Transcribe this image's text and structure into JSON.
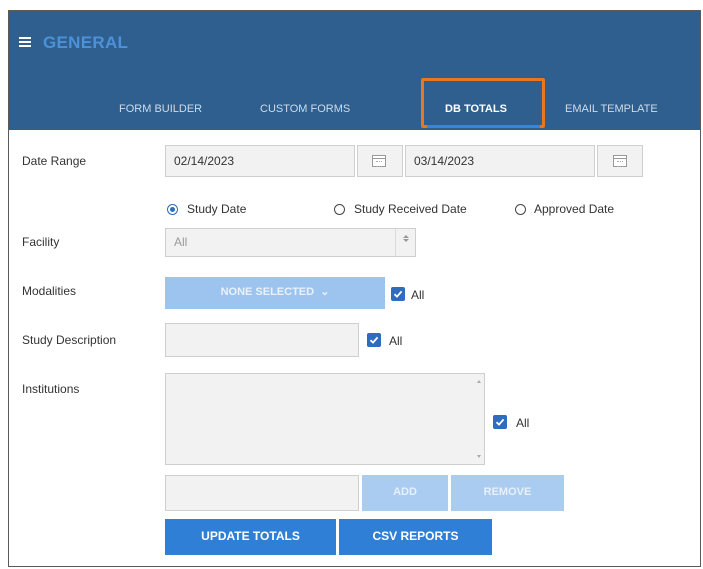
{
  "header": {
    "title": "GENERAL",
    "menu_icon": "hamburger-menu-icon"
  },
  "tabs": [
    {
      "label": "FORM BUILDER",
      "active": false
    },
    {
      "label": "CUSTOM FORMS",
      "active": false
    },
    {
      "label": "DB TOTALS",
      "active": true
    },
    {
      "label": "EMAIL TEMPLATE",
      "active": false
    }
  ],
  "colors": {
    "header_bg": "#2e5f8f",
    "accent": "#2f7fd6",
    "highlight": "#e87722"
  },
  "form": {
    "date_range": {
      "label": "Date Range",
      "start": "02/14/2023",
      "end": "03/14/2023",
      "icon": "calendar-icon"
    },
    "date_type": {
      "options": [
        "Study Date",
        "Study Received Date",
        "Approved Date"
      ],
      "selected": "Study Date"
    },
    "facility": {
      "label": "Facility",
      "value": "All"
    },
    "modalities": {
      "label": "Modalities",
      "button_label": "NONE SELECTED",
      "all_label": "All",
      "all_checked": true
    },
    "study_description": {
      "label": "Study Description",
      "value": "",
      "all_label": "All",
      "all_checked": true
    },
    "institutions": {
      "label": "Institutions",
      "all_label": "All",
      "all_checked": true,
      "add_input": "",
      "add_label": "ADD",
      "remove_label": "REMOVE"
    },
    "buttons": {
      "update_totals": "UPDATE TOTALS",
      "csv_reports": "CSV REPORTS"
    }
  }
}
